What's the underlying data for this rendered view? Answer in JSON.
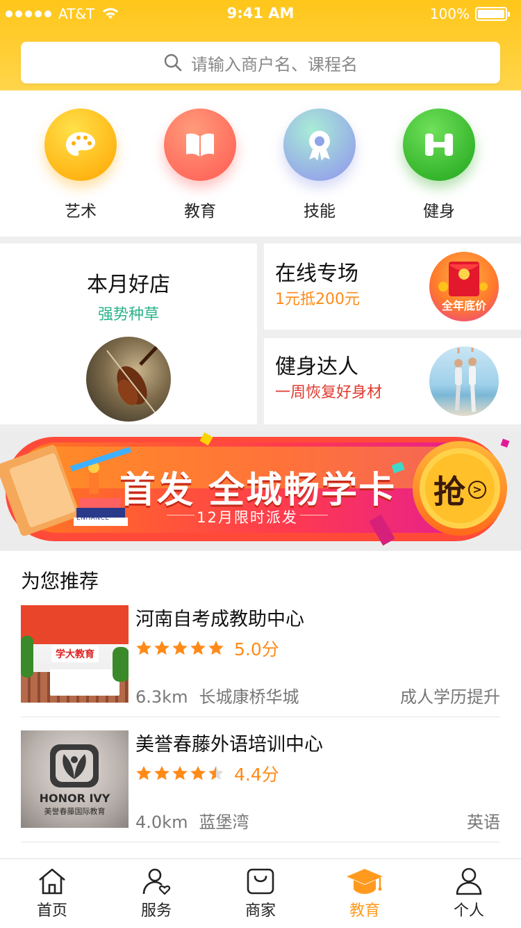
{
  "status_bar": {
    "carrier": "AT&T",
    "time": "9:41 AM",
    "battery": "100%"
  },
  "search": {
    "placeholder": "请输入商户名、课程名"
  },
  "categories": [
    {
      "label": "艺术",
      "icon": "palette-icon",
      "color": "#ffae00"
    },
    {
      "label": "教育",
      "icon": "book-icon",
      "color": "#ff6e5a"
    },
    {
      "label": "技能",
      "icon": "badge-icon",
      "color": "#8ea6e8"
    },
    {
      "label": "健身",
      "icon": "dumbbell-icon",
      "color": "#3fbf2f"
    }
  ],
  "promo": {
    "monthly": {
      "title": "本月好店",
      "subtitle": "强势种草",
      "image": "violin-photo"
    },
    "online": {
      "title": "在线专场",
      "subtitle": "1元抵200元",
      "badge": "全年底价"
    },
    "fitness": {
      "title": "健身达人",
      "subtitle": "一周恢复好身材",
      "image": "yoga-photo"
    }
  },
  "banner": {
    "headline": "首发 全城畅学卡",
    "sub": "12月限时派发",
    "cta": "抢",
    "book_text": "ENHANCE"
  },
  "recommend": {
    "title": "为您推荐",
    "items": [
      {
        "name": "河南自考成教助中心",
        "rating": 5.0,
        "score": "5.0分",
        "distance": "6.3km",
        "area": "长城康桥华城",
        "tag": "成人学历提升",
        "logo_text": "学大教育"
      },
      {
        "name": "美誉春藤外语培训中心",
        "rating": 4.4,
        "score": "4.4分",
        "distance": "4.0km",
        "area": "蓝堡湾",
        "tag": "英语",
        "logo_text": "HONOR IVY",
        "logo_sub": "美誉春藤国际教育"
      }
    ]
  },
  "tabbar": [
    {
      "label": "首页",
      "icon": "home-icon",
      "active": false
    },
    {
      "label": "服务",
      "icon": "service-icon",
      "active": false
    },
    {
      "label": "商家",
      "icon": "shop-bag-icon",
      "active": false
    },
    {
      "label": "教育",
      "icon": "graduation-cap-icon",
      "active": true
    },
    {
      "label": "个人",
      "icon": "person-icon",
      "active": false
    }
  ],
  "colors": {
    "brand_yellow": "#ffc61a",
    "accent_orange": "#ff8a18",
    "promo_green": "#2bb38a",
    "promo_red": "#e03a2f",
    "active_tab": "#ff9a1f"
  }
}
